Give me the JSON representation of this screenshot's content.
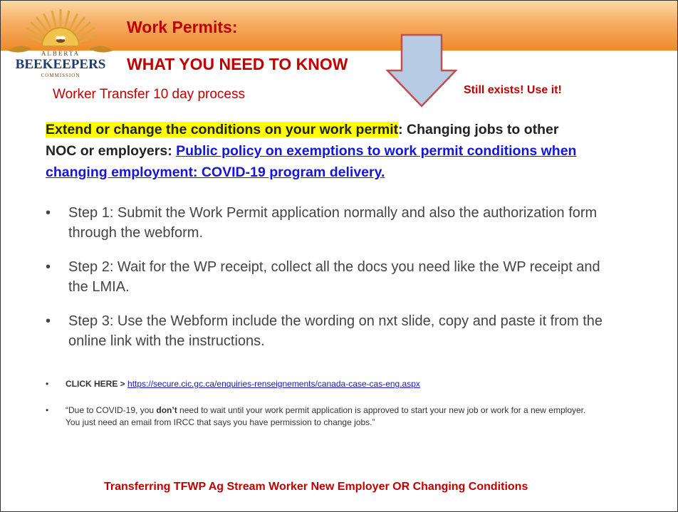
{
  "header": {
    "logo": {
      "top_text": "ALBERTA",
      "name": "BEEKEEPERS",
      "bottom_text": "COMMISSION"
    },
    "title_line1": "Work Permits:",
    "title_line2": "WHAT YOU NEED TO KNOW"
  },
  "subtitle": "Worker Transfer 10 day process",
  "callout": "Still exists!  Use it!",
  "intro": {
    "highlight": "Extend or change the conditions on your work permit",
    "text": ": Changing jobs to other NOC or employers: ",
    "link": "Public policy on exemptions to work permit conditions when changing employment: COVID-19 program delivery."
  },
  "steps": [
    "Step 1:  Submit the Work Permit application normally and also the authorization form through the webform.",
    "Step 2: Wait for the WP receipt, collect all the docs you need like the WP receipt and the LMIA.",
    "Step 3: Use the Webform include the wording on nxt slide, copy and paste it from the online link with the instructions."
  ],
  "click_here": {
    "label": "CLICK HERE >",
    "url": "https://secure.cic.gc.ca/enquiries-renseignements/canada-case-cas-eng.aspx"
  },
  "quote": {
    "before": "“Due to COVID-19, you ",
    "bold": "don’t",
    "after": " need to wait until your work permit application is approved to start your new job or work for a new employer. You just need an email from IRCC that says you have permission to change jobs.”"
  },
  "footer": "Transferring TFWP Ag Stream Worker New Employer OR Changing Conditions",
  "colors": {
    "title_red": "#c00000",
    "link_blue": "#1515d6",
    "highlight": "#ffff00",
    "arrow_fill": "#b7cce4",
    "header_orange": "#ee8a2a"
  }
}
